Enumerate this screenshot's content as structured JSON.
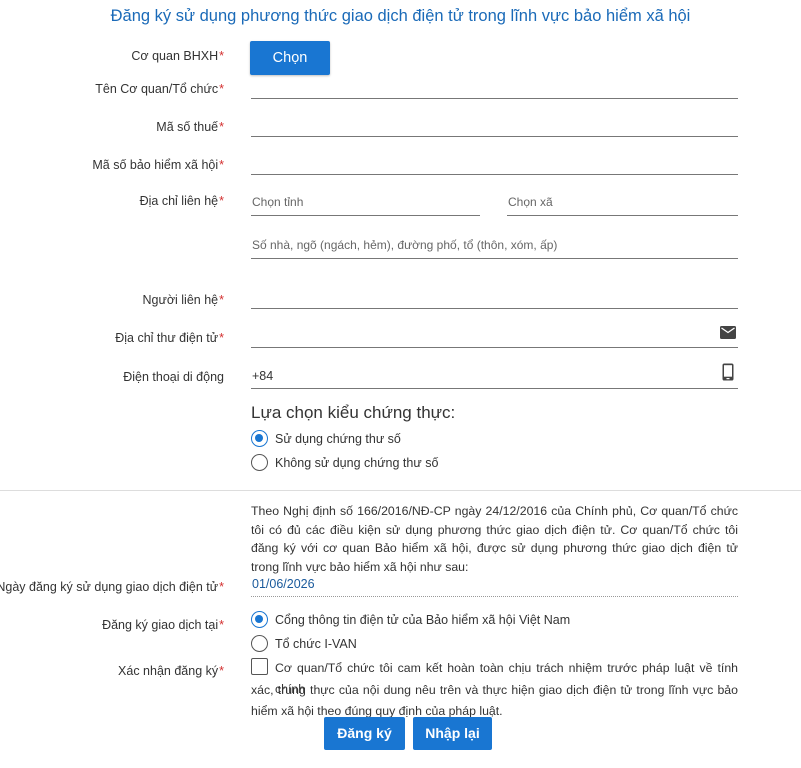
{
  "title": "Đăng ký sử dụng phương thức giao dịch điện tử trong lĩnh vực bảo hiểm xã hội",
  "fields": {
    "agency": {
      "label": "Cơ quan BHXH",
      "button": "Chọn"
    },
    "org_name": {
      "label": "Tên Cơ quan/Tổ chức"
    },
    "tax_code": {
      "label": "Mã số thuế"
    },
    "social_code": {
      "label": "Mã số bảo hiểm xã hội"
    },
    "address": {
      "label": "Địa chỉ liên hệ",
      "province_placeholder": "Chọn tỉnh",
      "commune_placeholder": "Chọn xã",
      "street_placeholder": "Số nhà, ngõ (ngách, hẻm), đường phố, tổ (thôn, xóm, ấp)"
    },
    "contact_person": {
      "label": "Người liên hệ"
    },
    "email": {
      "label": "Địa chỉ thư điện tử"
    },
    "phone": {
      "label": "Điện thoại di động",
      "value": "+84"
    }
  },
  "required_mark": "*",
  "auth": {
    "title": "Lựa chọn kiểu chứng thực:",
    "options": [
      {
        "label": "Sử dụng chứng thư số",
        "selected": true
      },
      {
        "label": "Không sử dụng chứng thư số",
        "selected": false
      }
    ]
  },
  "statement": "Theo Nghị định số 166/2016/NĐ-CP ngày 24/12/2016 của Chính phủ, Cơ quan/Tổ chức tôi có đủ các điều kiện sử dụng phương thức giao dịch điện tử. Cơ quan/Tổ chức tôi đăng ký với cơ quan Bảo hiểm xã hội, được sử dụng phương thức giao dịch điện tử trong lĩnh vực bảo hiểm xã hội như sau:",
  "registration_date": {
    "label": "Ngày đăng ký sử dụng giao dịch điện tử",
    "value": "01/06/2026"
  },
  "register_at": {
    "label": "Đăng ký giao dịch tại",
    "options": [
      {
        "label": "Cổng thông tin điện tử của Bảo hiểm xã hội Việt Nam",
        "selected": true
      },
      {
        "label": "Tổ chức I-VAN",
        "selected": false
      }
    ]
  },
  "confirm": {
    "label": "Xác nhận đăng ký",
    "text_line1": "Cơ quan/Tổ chức tôi cam kết hoàn toàn chịu trách nhiệm trước pháp luật về tính chính",
    "text_rest": "xác, trung thực của nội dung nêu trên và thực hiện giao dịch điện tử trong lĩnh vực bảo hiểm xã hội theo đúng quy định của pháp luật.",
    "checked": false
  },
  "buttons": {
    "submit": "Đăng ký",
    "reset": "Nhập lại"
  },
  "colors": {
    "primary": "#1976d2",
    "title": "#1a6ab8",
    "required": "#d32f2f"
  },
  "icons": {
    "email": "envelope-icon",
    "phone": "mobile-phone-icon"
  }
}
